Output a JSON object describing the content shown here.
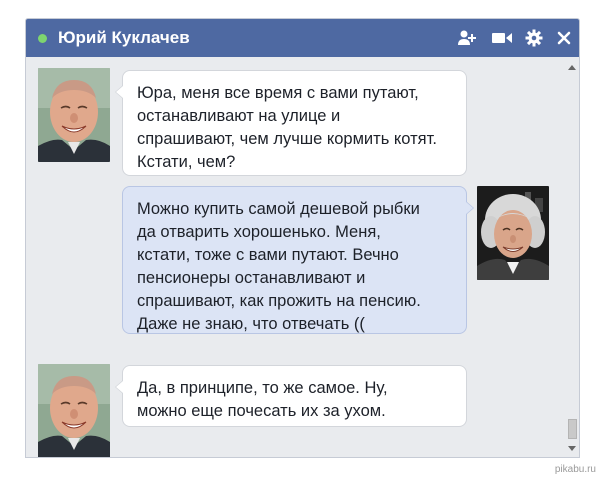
{
  "chat": {
    "contact_name": "Юрий Куклачев",
    "status_color": "#7ed56f",
    "header_icons": [
      "add-friend-icon",
      "video-call-icon",
      "gear-icon",
      "close-icon"
    ]
  },
  "messages": [
    {
      "side": "left",
      "lines": [
        "Юра, меня все время с вами путают,",
        "останавливают на улице и",
        "спрашивают, чем лучше кормить котят.",
        "Кстати, чем?"
      ]
    },
    {
      "side": "right",
      "lines": [
        "Можно купить самой дешевой рыбки",
        "да отварить хорошенько. Меня,",
        "кстати, тоже с вами путают. Вечно",
        "пенсионеры останавливают и",
        "спрашивают, как прожить на пенсию.",
        "Даже не знаю, что отвечать (("
      ]
    },
    {
      "side": "left",
      "lines": [
        "Да, в принципе, то же самое. Ну,",
        "можно еще почесать их за ухом."
      ]
    }
  ],
  "watermark": "pikabu.ru",
  "colors": {
    "titlebar": "#4e69a2",
    "chat_background": "#e9ebee",
    "incoming_bubble": "#ffffff",
    "outgoing_bubble": "#dce4f5"
  }
}
